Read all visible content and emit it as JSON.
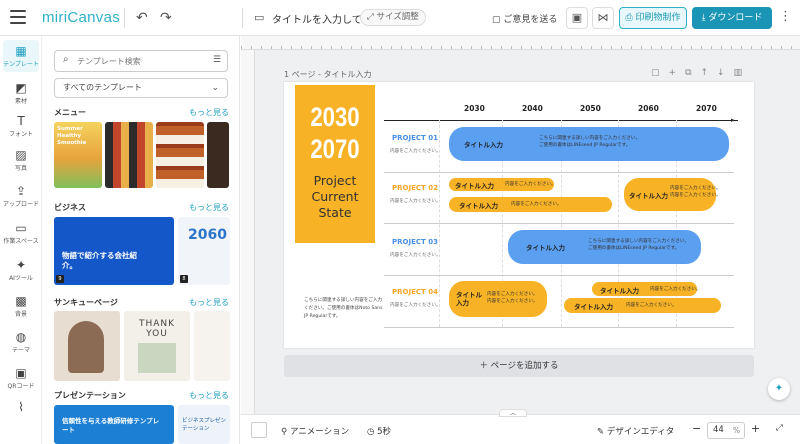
{
  "app": {
    "logo": "miriCanvas",
    "doc_title": "タイトルを入力して...",
    "size_label": "サイズ調整",
    "feedback": "ご意見を送る",
    "print_label": "印刷物制作",
    "download_label": "ダウンロード"
  },
  "rail": [
    {
      "label": "テンプレート",
      "icon": "template-icon",
      "glyph": "▦"
    },
    {
      "label": "素材",
      "icon": "shapes-icon",
      "glyph": "◩"
    },
    {
      "label": "フォント",
      "icon": "text-icon",
      "glyph": "T"
    },
    {
      "label": "写真",
      "icon": "photo-icon",
      "glyph": "▨"
    },
    {
      "label": "アップロード",
      "icon": "upload-icon",
      "glyph": "⇪"
    },
    {
      "label": "作業スペース",
      "icon": "folder-icon",
      "glyph": "▭"
    },
    {
      "label": "AIツール",
      "icon": "ai-sparkle-icon",
      "glyph": "✦"
    },
    {
      "label": "背景",
      "icon": "background-icon",
      "glyph": "▩"
    },
    {
      "label": "テーマ",
      "icon": "palette-icon",
      "glyph": "◍"
    },
    {
      "label": "QRコード",
      "icon": "qr-code-icon",
      "glyph": "▣"
    },
    {
      "label": "",
      "icon": "chart-icon",
      "glyph": "⌇"
    }
  ],
  "panel": {
    "search_placeholder": "テンプレート検索",
    "filter_selected": "すべてのテンプレート",
    "sections": [
      {
        "title": "メニュー",
        "more": "もっと見る"
      },
      {
        "title": "ビジネス",
        "more": "もっと見る"
      },
      {
        "title": "サンキューページ",
        "more": "もっと見る"
      },
      {
        "title": "プレゼンテーション",
        "more": "もっと見る"
      }
    ],
    "thumbs": {
      "menu1": "Summer Healthy Smoothie",
      "biz1": "物語で紹介する会社紹介。",
      "biz1_badge": "9",
      "biz2": "2060 CONFERENCE",
      "biz2_badge": "8",
      "thanks": "THANK YOU",
      "pres1": "信頼性を与える教師研修テンプレート",
      "pres2": "ビジネスプレゼンテーション"
    }
  },
  "canvas": {
    "page_label": "1 ページ - タイトル入力",
    "add_page": "ページを追加する",
    "yellow_year1": "2030",
    "yellow_year2": "2070",
    "yellow_sub": "Project Current State",
    "years": [
      "2030",
      "2040",
      "2050",
      "2060",
      "2070"
    ],
    "row_sub": "内容をご入力ください。",
    "projects": [
      {
        "name": "PROJECT 01",
        "color": "#4a90e2"
      },
      {
        "name": "PROJECT 02",
        "color": "#f5a623"
      },
      {
        "name": "PROJECT 03",
        "color": "#4a90e2"
      },
      {
        "name": "PROJECT 04",
        "color": "#f5a623"
      }
    ],
    "pill_title": "タイトル入力",
    "pill_title_wrap": "タイトル 入力",
    "pill_text": "内容をご入力ください。",
    "pill_desc_1": "こちらに関連する詳しい内容をご入力ください。",
    "pill_desc_2": "ご使用の書体はLINEseed JP Regularです。",
    "note": "こちらに関連する詳しい内容をご入力ください。ご使用の書体はNoto Sans JP Regularです。",
    "blue": "#5b9ff0",
    "yellow": "#f7b225"
  },
  "bottom": {
    "animation": "アニメーション",
    "duration": "5秒",
    "design_editor": "デザインエディタ",
    "zoom": "44",
    "zoom_unit": "%"
  }
}
